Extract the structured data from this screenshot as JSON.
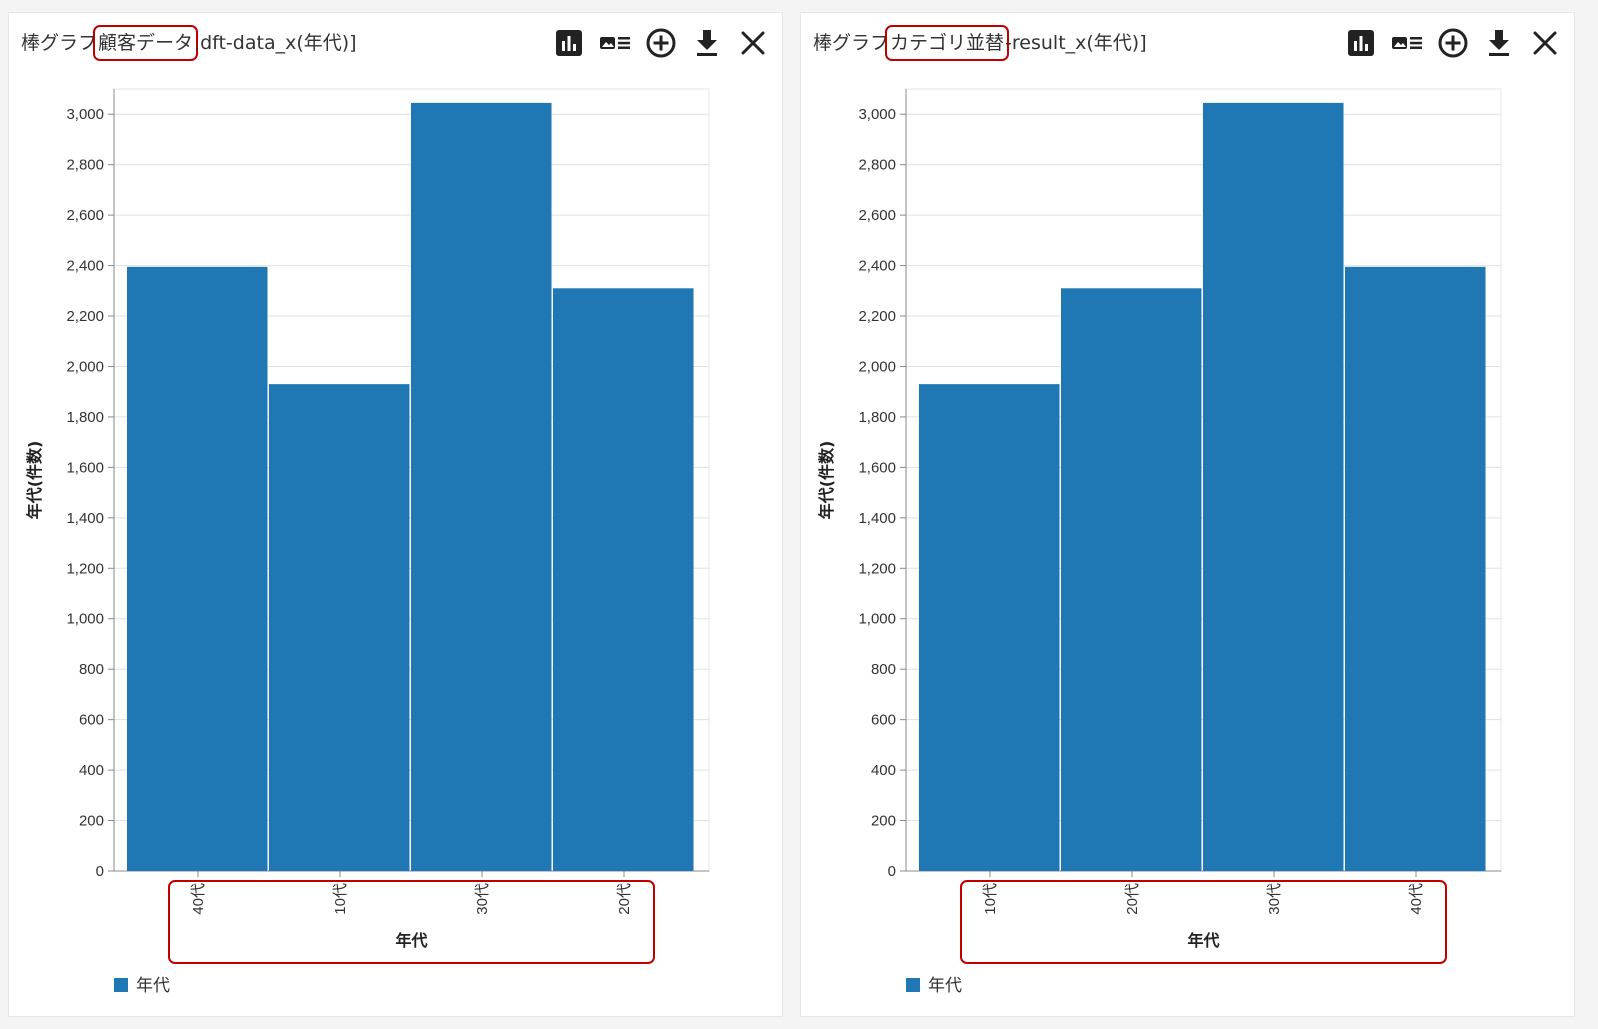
{
  "colors": {
    "bar": "#1f77b4",
    "highlight": "#c00000",
    "grid": "#e0e0e0",
    "axis": "#888888"
  },
  "toolbar_icons": [
    "bar-chart-icon",
    "legend-icon",
    "add-circle-icon",
    "download-icon",
    "close-icon"
  ],
  "panels": [
    {
      "title_prefix": "棒グラフ",
      "title_highlight": "顧客データ",
      "title_suffix": ".dft-data_x(年代)]"
    },
    {
      "title_prefix": "棒グラフ",
      "title_highlight": "カテゴリ並替",
      "title_suffix": "-result_x(年代)]"
    }
  ],
  "chart_data": [
    {
      "type": "bar",
      "categories": [
        "40代",
        "10代",
        "30代",
        "20代"
      ],
      "series": [
        {
          "name": "年代",
          "values": [
            2395,
            1930,
            3045,
            2310
          ]
        }
      ],
      "xlabel": "年代",
      "ylabel": "年代(件数)",
      "ylim": [
        0,
        3100
      ],
      "yticks": [
        0,
        200,
        400,
        600,
        800,
        1000,
        1200,
        1400,
        1600,
        1800,
        2000,
        2200,
        2400,
        2600,
        2800,
        3000
      ],
      "ytick_labels": [
        "0",
        "200",
        "400",
        "600",
        "800",
        "1,000",
        "1,200",
        "1,400",
        "1,600",
        "1,800",
        "2,000",
        "2,200",
        "2,400",
        "2,600",
        "2,800",
        "3,000"
      ],
      "grid": true,
      "legend": "bottom-left",
      "legend_label": "年代"
    },
    {
      "type": "bar",
      "categories": [
        "10代",
        "20代",
        "30代",
        "40代"
      ],
      "series": [
        {
          "name": "年代",
          "values": [
            1930,
            2310,
            3045,
            2395
          ]
        }
      ],
      "xlabel": "年代",
      "ylabel": "年代(件数)",
      "ylim": [
        0,
        3100
      ],
      "yticks": [
        0,
        200,
        400,
        600,
        800,
        1000,
        1200,
        1400,
        1600,
        1800,
        2000,
        2200,
        2400,
        2600,
        2800,
        3000
      ],
      "ytick_labels": [
        "0",
        "200",
        "400",
        "600",
        "800",
        "1,000",
        "1,200",
        "1,400",
        "1,600",
        "1,800",
        "2,000",
        "2,200",
        "2,400",
        "2,600",
        "2,800",
        "3,000"
      ],
      "grid": true,
      "legend": "bottom-left",
      "legend_label": "年代"
    }
  ]
}
